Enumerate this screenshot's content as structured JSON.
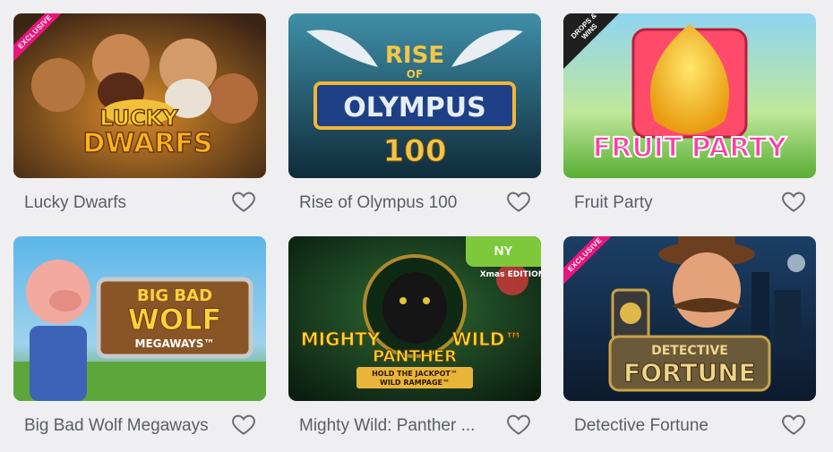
{
  "games": [
    {
      "title": "Lucky Dwarfs",
      "art_text": [
        "LUCKY",
        "DWARFS"
      ],
      "badge": "EXCLUSIVE"
    },
    {
      "title": "Rise of Olympus 100",
      "art_text": [
        "RISE",
        "OF",
        "OLYMPUS",
        "100"
      ],
      "badge": ""
    },
    {
      "title": "Fruit Party",
      "art_text": [
        "FRUIT PARTY"
      ],
      "badge": "DROPS & WINS"
    },
    {
      "title": "Big Bad Wolf Megaways",
      "art_text": [
        "BIG BAD",
        "WOLF",
        "MEGAWAYS™"
      ],
      "badge": ""
    },
    {
      "title": "Mighty Wild: Panther ...",
      "art_text": [
        "MIGHTY",
        "WILD™",
        "PANTHER",
        "HOLD THE JACKPOT™",
        "WILD RAMPAGE™",
        "Xmas EDITION"
      ],
      "badge": "NY"
    },
    {
      "title": "Detective Fortune",
      "art_text": [
        "DETECTIVE",
        "FORTUNE"
      ],
      "badge": "EXCLUSIVE"
    }
  ],
  "icons": {
    "favorite": "heart-outline-icon"
  },
  "colors": {
    "page_bg": "#efeff1",
    "title_text": "#5b5d66",
    "exclusive_ribbon": "#e7167d",
    "ny_badge": "#7ec83b"
  }
}
